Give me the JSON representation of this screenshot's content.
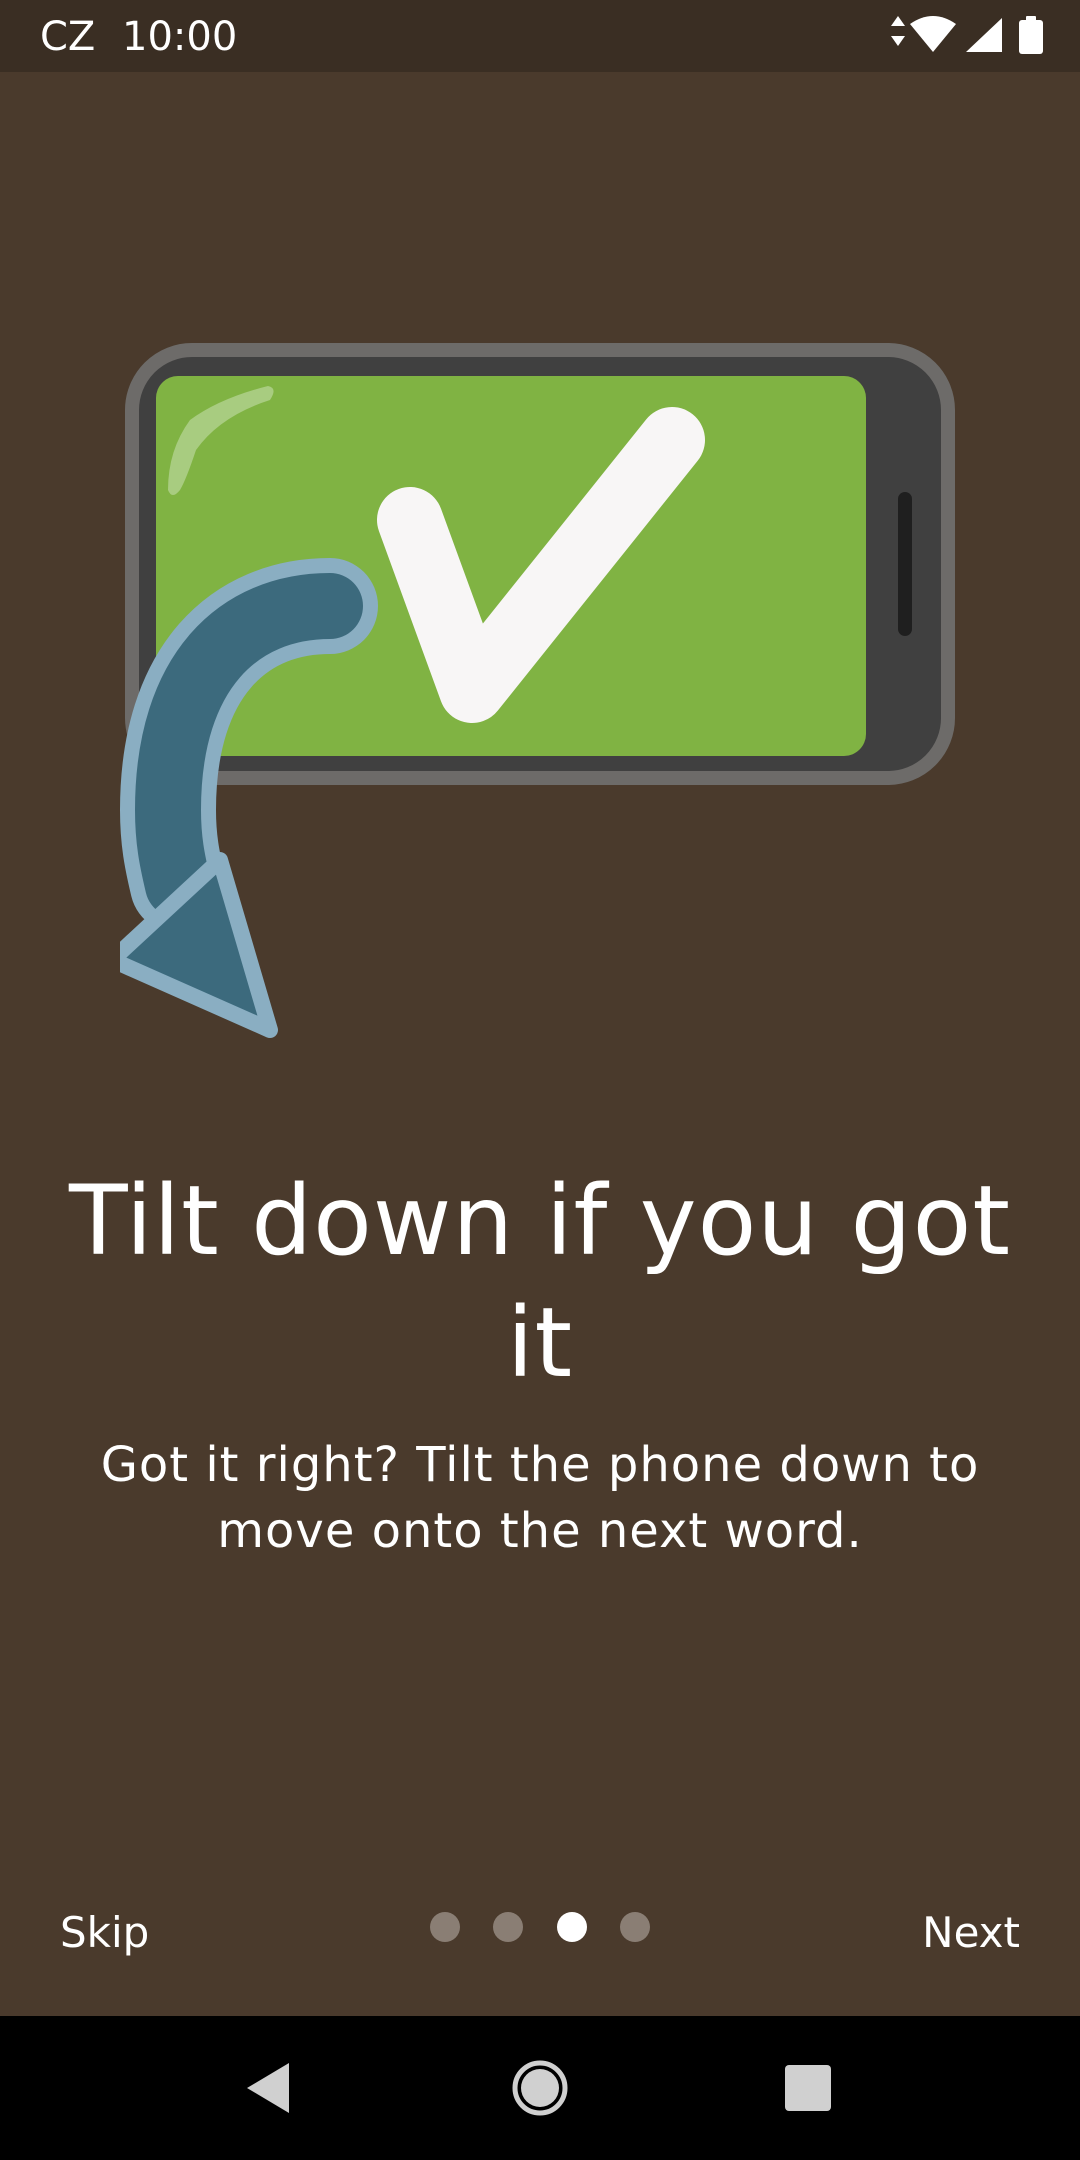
{
  "status_bar": {
    "carrier": "CZ",
    "time": "10:00",
    "icons": [
      "data-arrows-icon",
      "wifi-icon",
      "signal-icon",
      "battery-icon"
    ]
  },
  "onboarding": {
    "title": "Tilt down if you got it",
    "subtitle": "Got it right? Tilt the phone down to move onto the next word.",
    "illustration": "phone-tilt-down-checkmark",
    "colors": {
      "background": "#4a3a2c",
      "screen_green": "#80b343",
      "arrow": "#3c6a7d",
      "arrow_outline": "#8aaec2"
    }
  },
  "pager": {
    "skip_label": "Skip",
    "next_label": "Next",
    "page_count": 4,
    "current_page": 3
  },
  "nav_bar": {
    "buttons": [
      "back-icon",
      "home-icon",
      "recents-icon"
    ]
  }
}
